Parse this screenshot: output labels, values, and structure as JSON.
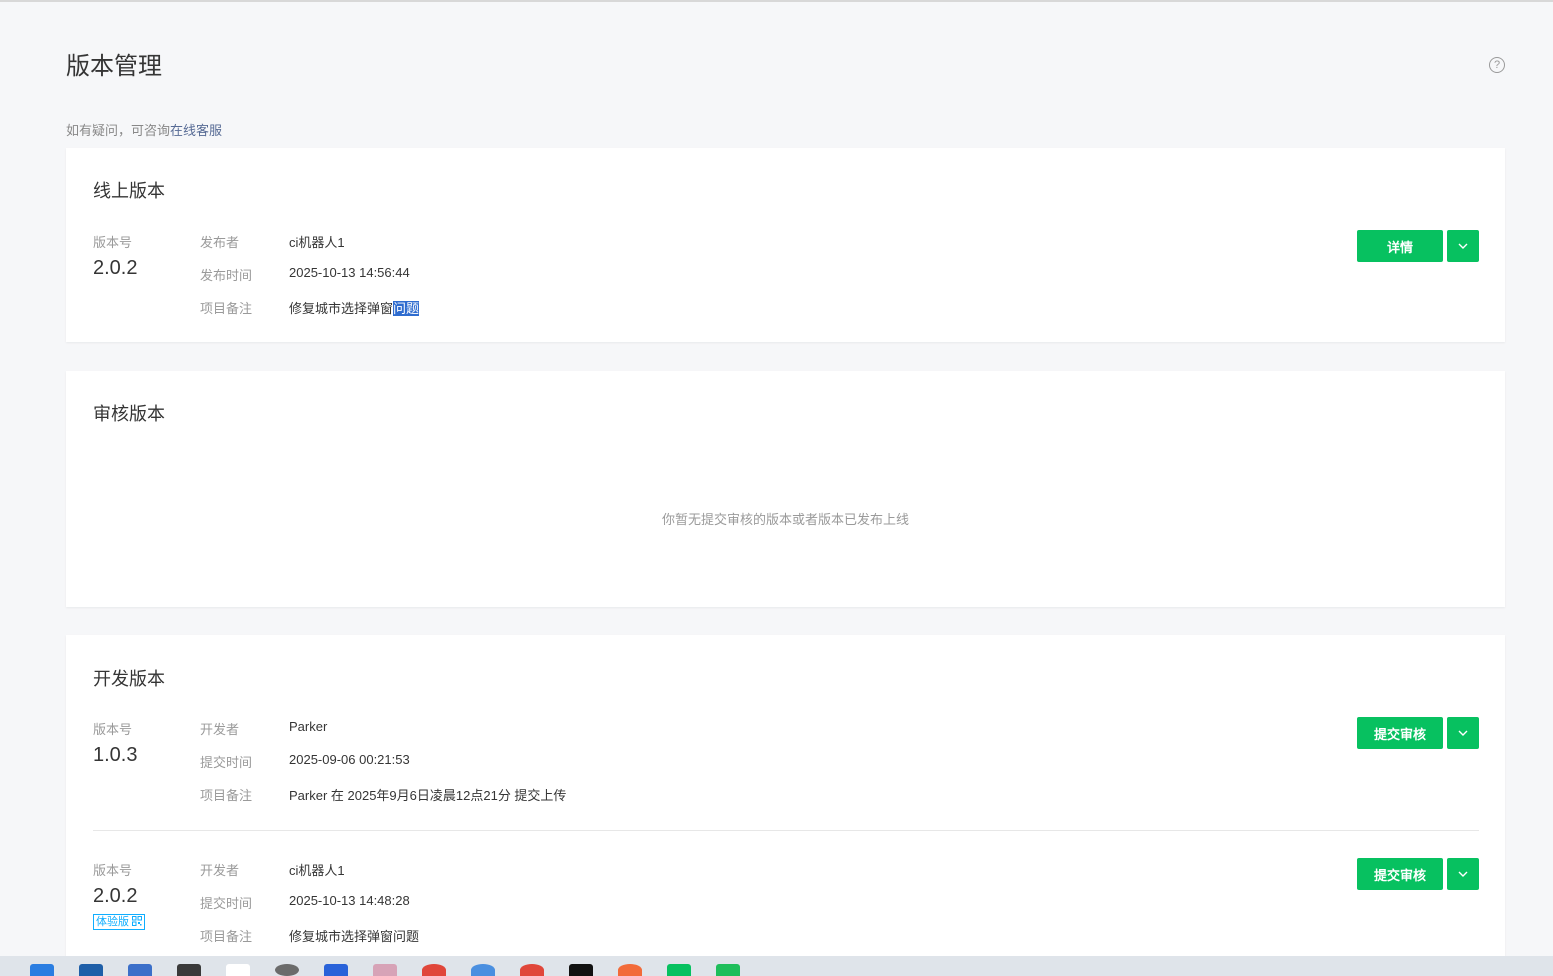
{
  "page": {
    "title": "版本管理",
    "help_icon": "?",
    "hint_prefix": "如有疑问，可咨询",
    "hint_link": "在线客服"
  },
  "online": {
    "title": "线上版本",
    "version_label": "版本号",
    "version": "2.0.2",
    "rows": [
      {
        "key": "发布者",
        "value": "ci机器人1"
      },
      {
        "key": "发布时间",
        "value": "2025-10-13 14:56:44"
      },
      {
        "key": "项目备注",
        "value": "修复城市选择弹窗",
        "selected": "问题"
      }
    ],
    "button": "详情"
  },
  "review": {
    "title": "审核版本",
    "empty": "你暂无提交审核的版本或者版本已发布上线"
  },
  "dev": {
    "title": "开发版本",
    "versions": [
      {
        "version_label": "版本号",
        "version": "1.0.3",
        "rows": [
          {
            "key": "开发者",
            "value": "Parker"
          },
          {
            "key": "提交时间",
            "value": "2025-09-06 00:21:53"
          },
          {
            "key": "项目备注",
            "value": "Parker 在 2025年9月6日凌晨12点21分 提交上传"
          }
        ],
        "button": "提交审核"
      },
      {
        "version_label": "版本号",
        "version": "2.0.2",
        "tag": "体验版",
        "rows": [
          {
            "key": "开发者",
            "value": "ci机器人1"
          },
          {
            "key": "提交时间",
            "value": "2025-10-13 14:48:28"
          },
          {
            "key": "项目备注",
            "value": "修复城市选择弹窗问题"
          }
        ],
        "button": "提交审核"
      }
    ]
  },
  "colors": {
    "primary": "#07c160",
    "link": "#576b95",
    "tag": "#10aeff",
    "selection": "#2f6ccf"
  },
  "taskbar_icons": [
    "edge-icon",
    "mail-icon",
    "wps-icon",
    "app-icon",
    "store-icon",
    "settings-icon",
    "outlook-icon",
    "git-icon",
    "chrome-icon",
    "search-icon",
    "chrome-alt-icon",
    "tiktok-icon",
    "app-orange-icon",
    "wechat-icon",
    "app-green-icon"
  ]
}
